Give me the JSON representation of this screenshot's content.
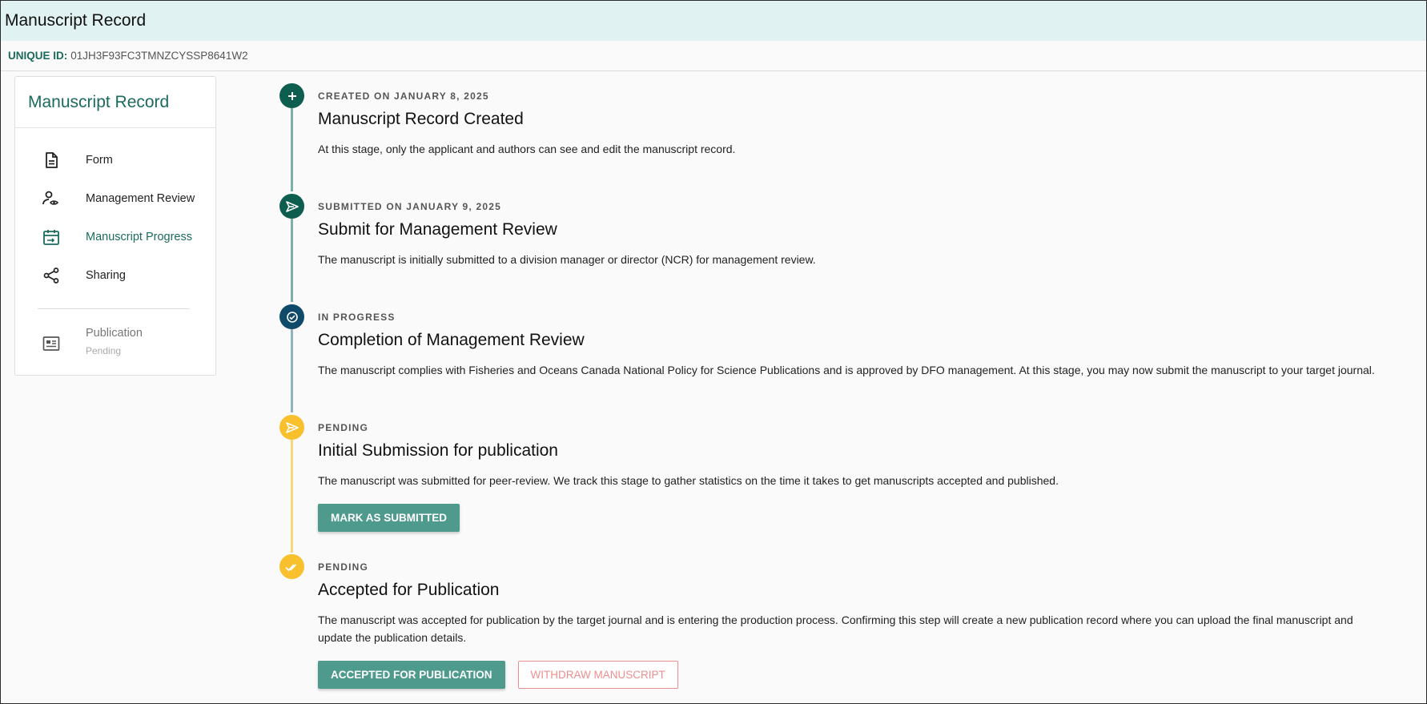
{
  "header": {
    "title": "Manuscript Record"
  },
  "id_bar": {
    "label": "UNIQUE ID:",
    "value": "01JH3F93FC3TMNZCYSSP8641W2"
  },
  "sidebar": {
    "title": "Manuscript Record",
    "items": [
      {
        "label": "Form",
        "icon": "document-icon",
        "active": false
      },
      {
        "label": "Management Review",
        "icon": "user-review-icon",
        "active": false
      },
      {
        "label": "Manuscript Progress",
        "icon": "calendar-progress-icon",
        "active": true
      },
      {
        "label": "Sharing",
        "icon": "share-icon",
        "active": false
      }
    ],
    "publication": {
      "label": "Publication",
      "sublabel": "Pending",
      "icon": "newspaper-icon"
    }
  },
  "colors": {
    "accent": "#1b6b5d",
    "done": "#0e5e4f",
    "in_progress": "#0f4a6b",
    "pending": "#f9c02d",
    "line_done": "#7fb0a8",
    "line_pending": "#f7d77b",
    "button": "#4e9a8d",
    "withdraw": "#ef8e8e"
  },
  "steps": [
    {
      "status": "CREATED ON JANUARY 8, 2025",
      "title": "Manuscript Record Created",
      "description": "At this stage, only the applicant and authors can see and edit the manuscript record.",
      "icon": "plus-icon"
    },
    {
      "status": "SUBMITTED ON JANUARY 9, 2025",
      "title": "Submit for Management Review",
      "description": "The manuscript is initially submitted to a division manager or director (NCR) for management review.",
      "icon": "send-icon"
    },
    {
      "status": "IN PROGRESS",
      "title": "Completion of Management Review",
      "description": "The manuscript complies with Fisheries and Oceans Canada National Policy for Science Publications and is approved by DFO management. At this stage, you may now submit the manuscript to your target journal.",
      "icon": "check-circle-icon"
    },
    {
      "status": "PENDING",
      "title": "Initial Submission for publication",
      "description": "The manuscript was submitted for peer-review. We track this stage to gather statistics on the time it takes to get manuscripts accepted and published.",
      "icon": "send-icon",
      "button": "MARK AS SUBMITTED"
    },
    {
      "status": "PENDING",
      "title": "Accepted for Publication",
      "description": "The manuscript was accepted for publication by the target journal and is entering the production process. Confirming this step will create a new publication record where you can upload the final manuscript and update the publication details.",
      "icon": "double-check-icon",
      "button_primary": "ACCEPTED FOR PUBLICATION",
      "button_secondary": "WITHDRAW MANUSCRIPT"
    }
  ]
}
